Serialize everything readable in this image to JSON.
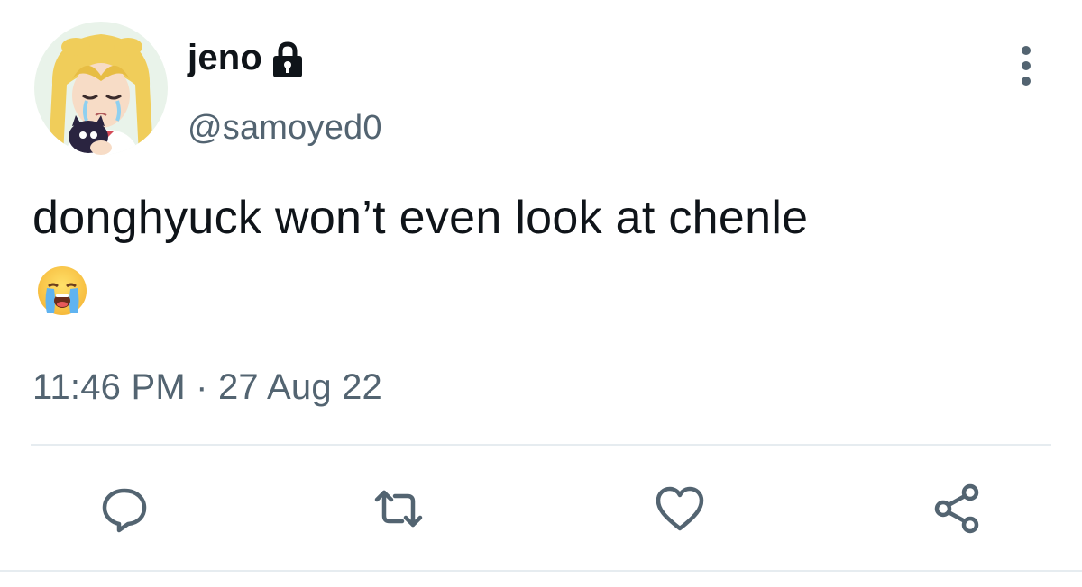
{
  "user": {
    "display_name": "jeno",
    "handle": "@samoyed0",
    "protected_icon": "lock-icon",
    "avatar": "avatar-image"
  },
  "tweet": {
    "text": "donghyuck won’t even look at chenle",
    "emoji": "😭",
    "timestamp": "11:46 PM · 27 Aug 22"
  },
  "actions": {
    "reply_icon": "reply-icon",
    "retweet_icon": "retweet-icon",
    "like_icon": "heart-icon",
    "share_icon": "share-icon"
  },
  "colors": {
    "primary_text": "#0f1419",
    "secondary_text": "#536471",
    "icon": "#536471",
    "divider": "#e6ecf0"
  }
}
